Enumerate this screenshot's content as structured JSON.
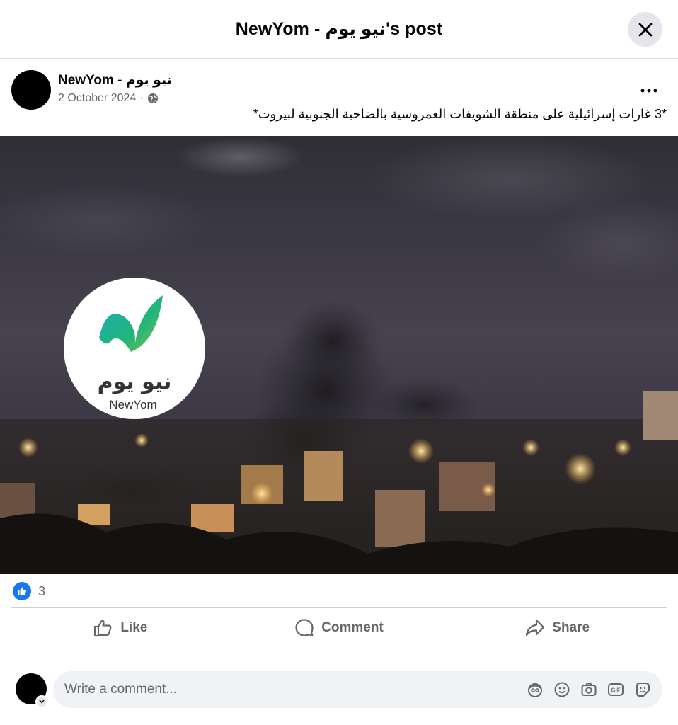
{
  "header": {
    "title": "NewYom - نيو يوم's post"
  },
  "post": {
    "author": "NewYom - نيو يوم",
    "date": "2 October 2024",
    "separator": "·",
    "privacy_icon": "globe-icon",
    "text": "*3 غارات إسرائيلية على منطقة الشويفات العمروسية بالضاحية الجنوبية لبيروت*"
  },
  "image": {
    "logo_arabic": "نيو يوم",
    "logo_latin": "NewYom"
  },
  "reactions": {
    "icon": "like-icon",
    "count": "3"
  },
  "actions": {
    "like": "Like",
    "comment": "Comment",
    "share": "Share"
  },
  "comment_box": {
    "placeholder": "Write a comment...",
    "icons": [
      "avatar-sticker-icon",
      "emoji-icon",
      "camera-icon",
      "gif-icon",
      "sticker-icon"
    ]
  },
  "colors": {
    "accent": "#1877f2",
    "secondary_text": "#65676b"
  }
}
